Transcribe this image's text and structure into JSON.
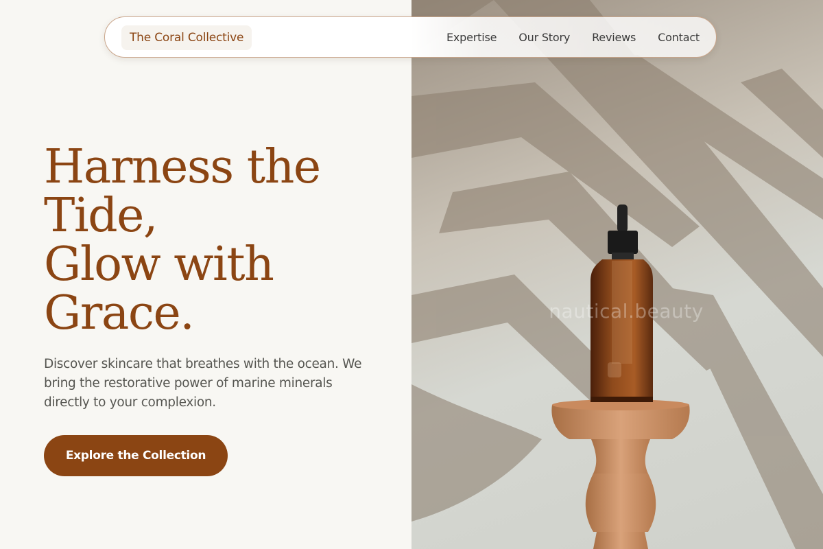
{
  "nav": {
    "brand": "The Coral Collective",
    "links": [
      "Expertise",
      "Our Story",
      "Reviews",
      "Contact"
    ]
  },
  "hero": {
    "headline_lines": [
      "Harness the",
      "Tide,",
      "Glow with",
      "Grace."
    ],
    "description": "Discover skincare that breathes with the ocean. We bring the restorative power of marine minerals directly to your complexion.",
    "cta_label": "Explore the Collection"
  },
  "image": {
    "watermark": "nautical.beauty"
  },
  "colors": {
    "brand": "#8b4513",
    "background": "#f8f7f3",
    "body_text": "#555550",
    "nav_text": "#3a3a3a"
  }
}
